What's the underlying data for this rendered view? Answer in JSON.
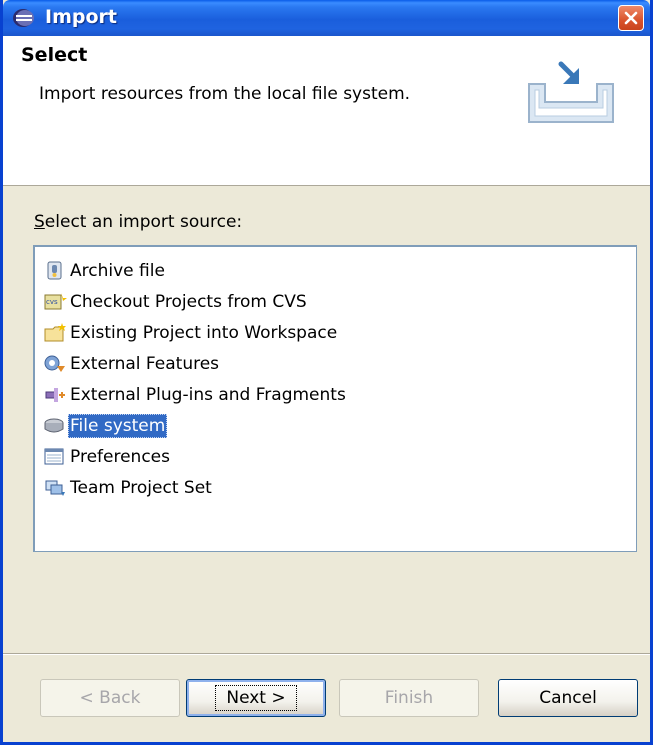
{
  "window": {
    "title": "Import",
    "accent_color": "#0a5ce8",
    "icons": {
      "app": "eclipse-icon",
      "close": "close-icon"
    }
  },
  "header": {
    "title": "Select",
    "description": "Import resources from the local file system.",
    "image": "import-wizard-banner-icon"
  },
  "source_list": {
    "label": "Select an import source:",
    "label_mnemonic": "S",
    "items": [
      {
        "label": "Archive file",
        "icon": "archive-file-icon",
        "selected": false
      },
      {
        "label": "Checkout Projects from CVS",
        "icon": "cvs-checkout-icon",
        "selected": false
      },
      {
        "label": "Existing Project into Workspace",
        "icon": "existing-project-icon",
        "selected": false
      },
      {
        "label": "External Features",
        "icon": "external-features-icon",
        "selected": false
      },
      {
        "label": "External Plug-ins and Fragments",
        "icon": "external-plugins-icon",
        "selected": false
      },
      {
        "label": "File system",
        "icon": "file-system-icon",
        "selected": true
      },
      {
        "label": "Preferences",
        "icon": "preferences-icon",
        "selected": false
      },
      {
        "label": "Team Project Set",
        "icon": "team-project-set-icon",
        "selected": false
      }
    ]
  },
  "buttons": {
    "back": {
      "label": "< Back",
      "enabled": false
    },
    "next": {
      "label": "Next >",
      "enabled": true
    },
    "finish": {
      "label": "Finish",
      "enabled": false
    },
    "cancel": {
      "label": "Cancel",
      "enabled": true
    }
  }
}
